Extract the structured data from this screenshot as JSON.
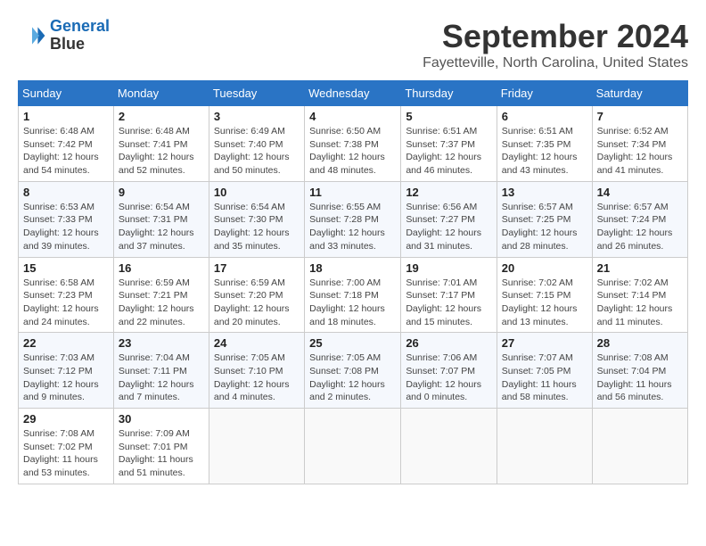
{
  "logo": {
    "line1": "General",
    "line2": "Blue"
  },
  "title": "September 2024",
  "subtitle": "Fayetteville, North Carolina, United States",
  "weekdays": [
    "Sunday",
    "Monday",
    "Tuesday",
    "Wednesday",
    "Thursday",
    "Friday",
    "Saturday"
  ],
  "weeks": [
    [
      {
        "day": "1",
        "info": "Sunrise: 6:48 AM\nSunset: 7:42 PM\nDaylight: 12 hours\nand 54 minutes."
      },
      {
        "day": "2",
        "info": "Sunrise: 6:48 AM\nSunset: 7:41 PM\nDaylight: 12 hours\nand 52 minutes."
      },
      {
        "day": "3",
        "info": "Sunrise: 6:49 AM\nSunset: 7:40 PM\nDaylight: 12 hours\nand 50 minutes."
      },
      {
        "day": "4",
        "info": "Sunrise: 6:50 AM\nSunset: 7:38 PM\nDaylight: 12 hours\nand 48 minutes."
      },
      {
        "day": "5",
        "info": "Sunrise: 6:51 AM\nSunset: 7:37 PM\nDaylight: 12 hours\nand 46 minutes."
      },
      {
        "day": "6",
        "info": "Sunrise: 6:51 AM\nSunset: 7:35 PM\nDaylight: 12 hours\nand 43 minutes."
      },
      {
        "day": "7",
        "info": "Sunrise: 6:52 AM\nSunset: 7:34 PM\nDaylight: 12 hours\nand 41 minutes."
      }
    ],
    [
      {
        "day": "8",
        "info": "Sunrise: 6:53 AM\nSunset: 7:33 PM\nDaylight: 12 hours\nand 39 minutes."
      },
      {
        "day": "9",
        "info": "Sunrise: 6:54 AM\nSunset: 7:31 PM\nDaylight: 12 hours\nand 37 minutes."
      },
      {
        "day": "10",
        "info": "Sunrise: 6:54 AM\nSunset: 7:30 PM\nDaylight: 12 hours\nand 35 minutes."
      },
      {
        "day": "11",
        "info": "Sunrise: 6:55 AM\nSunset: 7:28 PM\nDaylight: 12 hours\nand 33 minutes."
      },
      {
        "day": "12",
        "info": "Sunrise: 6:56 AM\nSunset: 7:27 PM\nDaylight: 12 hours\nand 31 minutes."
      },
      {
        "day": "13",
        "info": "Sunrise: 6:57 AM\nSunset: 7:25 PM\nDaylight: 12 hours\nand 28 minutes."
      },
      {
        "day": "14",
        "info": "Sunrise: 6:57 AM\nSunset: 7:24 PM\nDaylight: 12 hours\nand 26 minutes."
      }
    ],
    [
      {
        "day": "15",
        "info": "Sunrise: 6:58 AM\nSunset: 7:23 PM\nDaylight: 12 hours\nand 24 minutes."
      },
      {
        "day": "16",
        "info": "Sunrise: 6:59 AM\nSunset: 7:21 PM\nDaylight: 12 hours\nand 22 minutes."
      },
      {
        "day": "17",
        "info": "Sunrise: 6:59 AM\nSunset: 7:20 PM\nDaylight: 12 hours\nand 20 minutes."
      },
      {
        "day": "18",
        "info": "Sunrise: 7:00 AM\nSunset: 7:18 PM\nDaylight: 12 hours\nand 18 minutes."
      },
      {
        "day": "19",
        "info": "Sunrise: 7:01 AM\nSunset: 7:17 PM\nDaylight: 12 hours\nand 15 minutes."
      },
      {
        "day": "20",
        "info": "Sunrise: 7:02 AM\nSunset: 7:15 PM\nDaylight: 12 hours\nand 13 minutes."
      },
      {
        "day": "21",
        "info": "Sunrise: 7:02 AM\nSunset: 7:14 PM\nDaylight: 12 hours\nand 11 minutes."
      }
    ],
    [
      {
        "day": "22",
        "info": "Sunrise: 7:03 AM\nSunset: 7:12 PM\nDaylight: 12 hours\nand 9 minutes."
      },
      {
        "day": "23",
        "info": "Sunrise: 7:04 AM\nSunset: 7:11 PM\nDaylight: 12 hours\nand 7 minutes."
      },
      {
        "day": "24",
        "info": "Sunrise: 7:05 AM\nSunset: 7:10 PM\nDaylight: 12 hours\nand 4 minutes."
      },
      {
        "day": "25",
        "info": "Sunrise: 7:05 AM\nSunset: 7:08 PM\nDaylight: 12 hours\nand 2 minutes."
      },
      {
        "day": "26",
        "info": "Sunrise: 7:06 AM\nSunset: 7:07 PM\nDaylight: 12 hours\nand 0 minutes."
      },
      {
        "day": "27",
        "info": "Sunrise: 7:07 AM\nSunset: 7:05 PM\nDaylight: 11 hours\nand 58 minutes."
      },
      {
        "day": "28",
        "info": "Sunrise: 7:08 AM\nSunset: 7:04 PM\nDaylight: 11 hours\nand 56 minutes."
      }
    ],
    [
      {
        "day": "29",
        "info": "Sunrise: 7:08 AM\nSunset: 7:02 PM\nDaylight: 11 hours\nand 53 minutes."
      },
      {
        "day": "30",
        "info": "Sunrise: 7:09 AM\nSunset: 7:01 PM\nDaylight: 11 hours\nand 51 minutes."
      },
      {
        "day": "",
        "info": ""
      },
      {
        "day": "",
        "info": ""
      },
      {
        "day": "",
        "info": ""
      },
      {
        "day": "",
        "info": ""
      },
      {
        "day": "",
        "info": ""
      }
    ]
  ]
}
